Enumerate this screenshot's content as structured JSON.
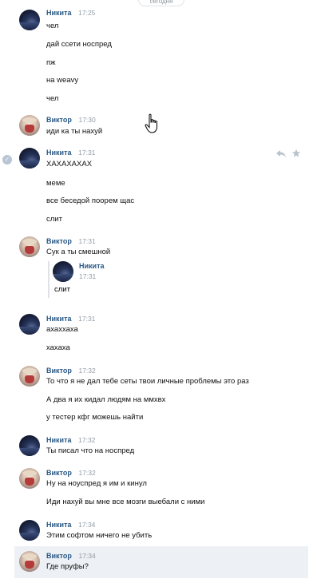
{
  "date_pill": "сегодня",
  "messages": [
    {
      "author": "Никита",
      "time": "17:25",
      "lines": [
        "чел",
        "дай ссети носпред",
        "пж",
        "на weavy",
        "чел"
      ]
    },
    {
      "author": "Виктор",
      "time": "17:30",
      "lines": [
        "иди ка ты нахуй"
      ]
    },
    {
      "author": "Никита",
      "time": "17:31",
      "lines": [
        "ХАХАХАХАХ",
        "меме",
        "все беседой поорем щас",
        "слит"
      ]
    },
    {
      "author": "Виктор",
      "time": "17:31",
      "lines": [
        "Сук а ты смешной"
      ],
      "quote": {
        "author": "Никита",
        "time": "17:31",
        "text": "слит"
      }
    },
    {
      "author": "Никита",
      "time": "17:31",
      "lines": [
        "ахаххаха",
        "хахаха"
      ]
    },
    {
      "author": "Виктор",
      "time": "17:32",
      "lines": [
        "То что я не дал тебе сеты твои личные проблемы это раз",
        "А два я их кидал людям на ммхвх",
        "у тестер кфг можешь найти"
      ]
    },
    {
      "author": "Никита",
      "time": "17:32",
      "lines": [
        "Ты писал что на носпред"
      ]
    },
    {
      "author": "Виктор",
      "time": "17:32",
      "lines": [
        "Ну на ноуспред я им и кинул",
        "Иди нахуй вы мне все мозги выебали с ними"
      ]
    },
    {
      "author": "Никита",
      "time": "17:34",
      "lines": [
        "Этим софтом ничего не убить"
      ]
    },
    {
      "author": "Виктор",
      "time": "17:34",
      "lines": [
        "Где пруфы?"
      ]
    }
  ],
  "icons": {
    "read_mark": "check-circle-icon",
    "reply": "reply-icon",
    "favorite": "star-icon",
    "cursor": "hand-pointer-icon"
  },
  "colors": {
    "name": "#2a5885",
    "time": "#939ba3",
    "selected_bg": "#edf0f4"
  }
}
